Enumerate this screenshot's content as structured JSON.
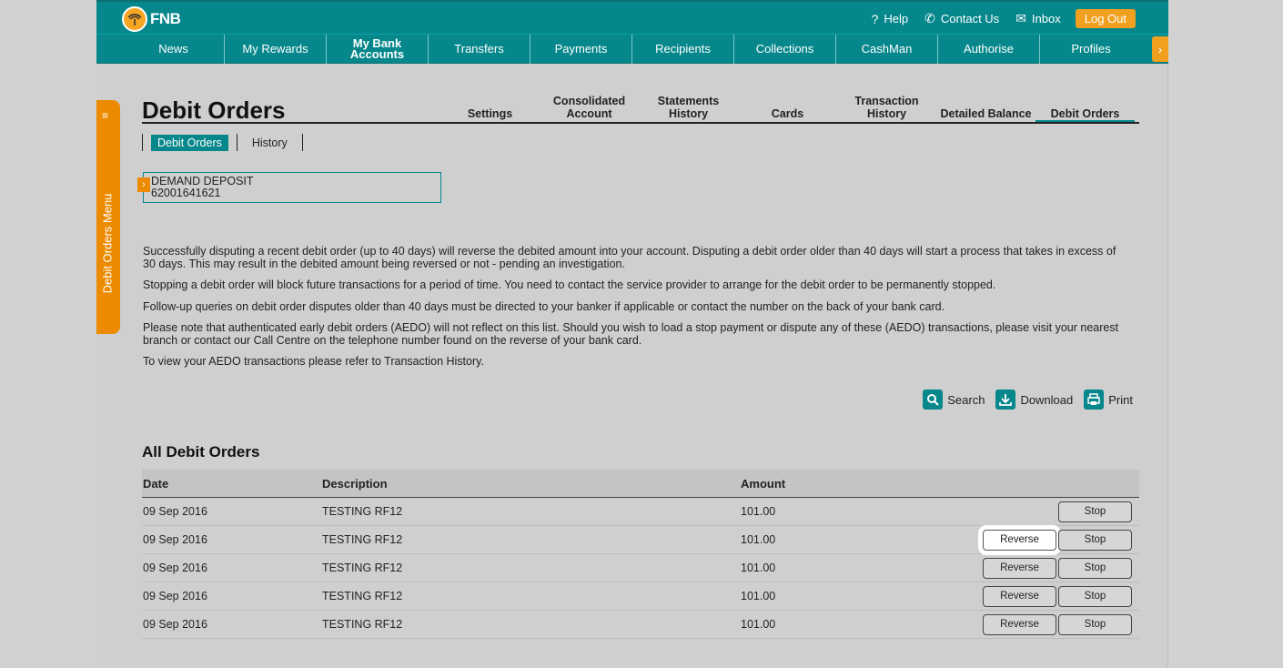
{
  "header": {
    "brand": "FNB",
    "links": [
      {
        "icon": "help-icon",
        "label": "Help"
      },
      {
        "icon": "phone-icon",
        "label": "Contact Us"
      },
      {
        "icon": "mail-icon",
        "label": "Inbox"
      }
    ],
    "logout_label": "Log Out"
  },
  "nav": {
    "items": [
      "News",
      "My Rewards",
      "My Bank Accounts",
      "Transfers",
      "Payments",
      "Recipients",
      "Collections",
      "CashMan",
      "Authorise",
      "Profiles"
    ],
    "active": "My Bank Accounts"
  },
  "side_menu": {
    "label": "Debit Orders Menu"
  },
  "page": {
    "title": "Debit Orders",
    "subtabs": [
      "Settings",
      "Consolidated Account",
      "Statements History",
      "Cards",
      "Transaction History",
      "Detailed Balance",
      "Debit Orders"
    ],
    "active_subtab": "Debit Orders"
  },
  "pills": {
    "items": [
      "Debit Orders",
      "History"
    ],
    "active": "Debit Orders"
  },
  "account": {
    "name": "DEMAND DEPOSIT",
    "number": "62001641621"
  },
  "info": [
    "Successfully disputing a recent debit order (up to 40 days) will reverse the debited amount into your account. Disputing a debit order older than 40 days will start a process that takes in excess of 30 days. This may result in the debited amount being reversed or not - pending an investigation.",
    "Stopping a debit order will block future transactions for a period of time. You need to contact the service provider to arrange for the debit order to be permanently stopped.",
    "Follow-up queries on debit order disputes older than 40 days must be directed to your banker if applicable or contact the number on the back of your bank card.",
    "Please note that authenticated early debit orders (AEDO) will not reflect on this list. Should you wish to load a stop payment or dispute any of these (AEDO) transactions, please visit your nearest branch or contact our Call Centre on the telephone number found on the reverse of your bank card.",
    "To view your AEDO transactions please refer to Transaction History."
  ],
  "actions": [
    {
      "icon": "search-icon",
      "label": "Search"
    },
    {
      "icon": "download-icon",
      "label": "Download"
    },
    {
      "icon": "print-icon",
      "label": "Print"
    }
  ],
  "table": {
    "title": "All Debit Orders",
    "columns": [
      "Date",
      "Description",
      "Amount"
    ],
    "reverse_label": "Reverse",
    "stop_label": "Stop",
    "rows": [
      {
        "date": "09 Sep 2016",
        "description": "TESTING RF12",
        "amount": "101.00",
        "reverse": false,
        "stop": true
      },
      {
        "date": "09 Sep 2016",
        "description": "TESTING RF12",
        "amount": "101.00",
        "reverse": true,
        "stop": true,
        "highlight": true
      },
      {
        "date": "09 Sep 2016",
        "description": "TESTING RF12",
        "amount": "101.00",
        "reverse": true,
        "stop": true
      },
      {
        "date": "09 Sep 2016",
        "description": "TESTING RF12",
        "amount": "101.00",
        "reverse": true,
        "stop": true
      },
      {
        "date": "09 Sep 2016",
        "description": "TESTING RF12",
        "amount": "101.00",
        "reverse": true,
        "stop": true
      }
    ]
  },
  "colors": {
    "teal": "#05878b",
    "orange": "#ec8a00",
    "background": "#cfcfcf"
  }
}
